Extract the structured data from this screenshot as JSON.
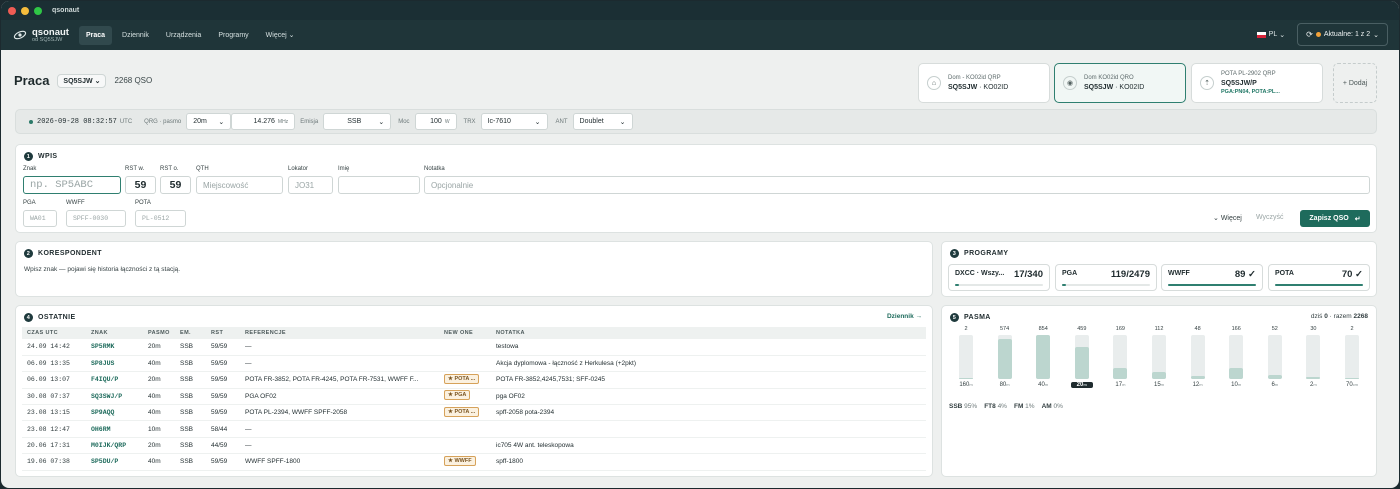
{
  "window": {
    "title": "qsonaut"
  },
  "brand": {
    "name": "qsonaut",
    "sub": "od SQ5SJW"
  },
  "nav": {
    "items": [
      "Praca",
      "Dziennik",
      "Urządzenia",
      "Programy",
      "Więcej"
    ]
  },
  "lang": "PL",
  "status": {
    "label": "Aktualne: 1 z 2"
  },
  "page": {
    "title": "Praca",
    "callsign": "SQ5SJW",
    "qso_count": "2268 QSO"
  },
  "locations": [
    {
      "title": "Dom - KO02id QRP",
      "call": "SQ5SJW",
      "loc": " · KO02ID"
    },
    {
      "title": "Dom KO02id QRO",
      "call": "SQ5SJW",
      "loc": " · KO02ID"
    },
    {
      "title": "POTA PL-2902 QRP",
      "call": "SQ5SJW/P",
      "loc": "",
      "refs": "PGA:PN04, POTA:PL..."
    }
  ],
  "add_label": "+ Dodaj",
  "qro": {
    "timestamp": "2026-09-28 08:32:57",
    "tz": "UTC",
    "qrg_label": "QRG · pasmo",
    "band": "20m",
    "freq": "14.276",
    "freq_unit": "MHz",
    "mode_label": "Emisja",
    "mode": "SSB",
    "power_label": "Moc",
    "power": "100",
    "power_unit": "W",
    "trx_label": "TRX",
    "trx": "Ic-7610",
    "ant_label": "ANT",
    "ant": "Doublet"
  },
  "wpis": {
    "num": "1",
    "title": "WPIS",
    "labels": {
      "znak": "Znak",
      "rstw": "RST w.",
      "rsto": "RST o.",
      "qth": "QTH",
      "lokator": "Lokator",
      "imie": "Imię",
      "notatka": "Notatka",
      "pga": "PGA",
      "wwff": "WWFF",
      "pota": "POTA"
    },
    "placeholders": {
      "znak": "np. SP5ABC",
      "qth": "Miejscowość",
      "lokator": "JO31",
      "notatka": "Opcjonalnie",
      "pga": "WA01",
      "wwff": "SPFF-0030",
      "pota": "PL-0512"
    },
    "values": {
      "rstw": "59",
      "rsto": "59"
    },
    "more": "Więcej",
    "clear": "Wyczyść",
    "save": "Zapisz QSO"
  },
  "korespondent": {
    "num": "2",
    "title": "KORESPONDENT",
    "text": "Wpisz znak — pojawi się historia łączności z tą stacją."
  },
  "programy": {
    "num": "3",
    "title": "PROGRAMY",
    "items": [
      {
        "name": "DXCC · Wszy...",
        "value": "17/340",
        "progress": 0.05
      },
      {
        "name": "PGA",
        "value": "119/2479",
        "progress": 0.05
      },
      {
        "name": "WWFF",
        "value": "89 ✓",
        "progress": 1
      },
      {
        "name": "POTA",
        "value": "70 ✓",
        "progress": 1
      }
    ]
  },
  "ostatnie": {
    "num": "4",
    "title": "OSTATNIE",
    "link": "Dziennik →",
    "headers": [
      "CZAS UTC",
      "ZNAK",
      "PASMO",
      "EM.",
      "RST",
      "REFERENCJE",
      "NEW ONE",
      "NOTATKA"
    ],
    "rows": [
      {
        "time": "24.09 14:42",
        "call": "SP5RMK",
        "band": "20m",
        "mode": "SSB",
        "rst": "59/59",
        "refs": "—",
        "badge": "",
        "note": "testowa"
      },
      {
        "time": "06.09 13:35",
        "call": "SP8JUS",
        "band": "40m",
        "mode": "SSB",
        "rst": "59/59",
        "refs": "—",
        "badge": "",
        "note": "Akcja dyplomowa - łączność z Herkulesa (+2pkt)"
      },
      {
        "time": "06.09 13:07",
        "call": "F4IQU/P",
        "band": "20m",
        "mode": "SSB",
        "rst": "59/59",
        "refs": "POTA FR-3852, POTA FR-4245, POTA FR-7531, WWFF F...",
        "badge": "★ POTA ...",
        "note": "POTA FR-3852,4245,7531; SFF-0245"
      },
      {
        "time": "30.08 07:37",
        "call": "SQ3SWJ/P",
        "band": "40m",
        "mode": "SSB",
        "rst": "59/59",
        "refs": "PGA OF02",
        "badge": "★ PGA",
        "note": "pga OF02"
      },
      {
        "time": "23.08 13:15",
        "call": "SP9AQQ",
        "band": "40m",
        "mode": "SSB",
        "rst": "59/59",
        "refs": "POTA PL-2394, WWFF SPFF-2058",
        "badge": "★ POTA ...",
        "note": "spff-2058 pota-2394"
      },
      {
        "time": "23.08 12:47",
        "call": "OH6RM",
        "band": "10m",
        "mode": "SSB",
        "rst": "58/44",
        "refs": "—",
        "badge": "",
        "note": ""
      },
      {
        "time": "20.06 17:31",
        "call": "M0IJK/QRP",
        "band": "20m",
        "mode": "SSB",
        "rst": "44/59",
        "refs": "—",
        "badge": "",
        "note": "ic705 4W ant. teleskopowa"
      },
      {
        "time": "19.06 07:38",
        "call": "SP5DU/P",
        "band": "40m",
        "mode": "SSB",
        "rst": "59/59",
        "refs": "WWFF SPFF-1800",
        "badge": "★ WWFF",
        "note": "spff-1800"
      }
    ]
  },
  "pasma": {
    "num": "5",
    "title": "PASMA",
    "today_label": "dziś",
    "today": "0",
    "total_label": "razem",
    "total": "2268",
    "bands": [
      {
        "band": "160",
        "count": "2",
        "fill": 0.02
      },
      {
        "band": "80",
        "count": "574",
        "fill": 0.9
      },
      {
        "band": "40",
        "count": "854",
        "fill": 1
      },
      {
        "band": "20",
        "count": "459",
        "fill": 0.73,
        "selected": true
      },
      {
        "band": "17",
        "count": "169",
        "fill": 0.25
      },
      {
        "band": "15",
        "count": "112",
        "fill": 0.17
      },
      {
        "band": "12",
        "count": "48",
        "fill": 0.06
      },
      {
        "band": "10",
        "count": "166",
        "fill": 0.25
      },
      {
        "band": "6",
        "count": "52",
        "fill": 0.08
      },
      {
        "band": "2",
        "count": "30",
        "fill": 0.05
      },
      {
        "band": "70",
        "count": "2",
        "fill": 0.02
      }
    ],
    "band_unit": "m",
    "band_unit_70": "cm",
    "modes": [
      {
        "mode": "SSB",
        "pct": "95%"
      },
      {
        "mode": "FT8",
        "pct": "4%"
      },
      {
        "mode": "FM",
        "pct": "1%"
      },
      {
        "mode": "AM",
        "pct": "0%"
      }
    ]
  },
  "colors": {
    "accent": "#1e6b5c",
    "nav_bg": "#1f3539",
    "badge": "#d6a25a"
  }
}
